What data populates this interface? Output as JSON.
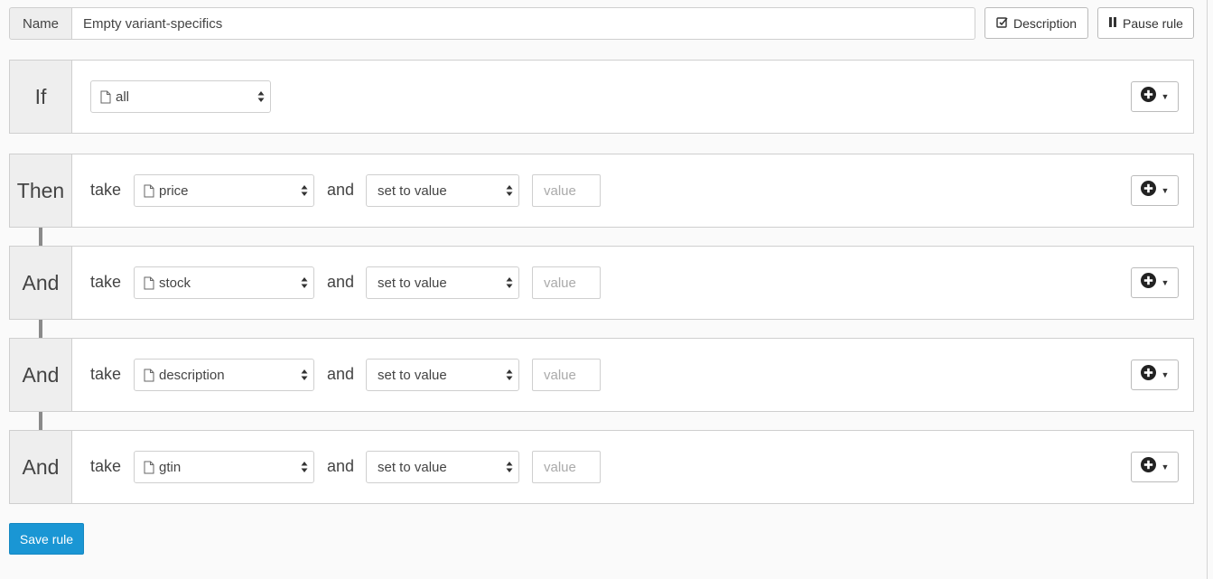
{
  "header": {
    "name_label": "Name",
    "name_value": "Empty variant-specifics",
    "description_button": "Description",
    "pause_button": "Pause rule"
  },
  "condition": {
    "label": "If",
    "selected": "all"
  },
  "actions": [
    {
      "label": "Then",
      "take_word": "take",
      "field": "price",
      "and_word": "and",
      "operation": "set to value",
      "value_placeholder": "value"
    },
    {
      "label": "And",
      "take_word": "take",
      "field": "stock",
      "and_word": "and",
      "operation": "set to value",
      "value_placeholder": "value"
    },
    {
      "label": "And",
      "take_word": "take",
      "field": "description",
      "and_word": "and",
      "operation": "set to value",
      "value_placeholder": "value"
    },
    {
      "label": "And",
      "take_word": "take",
      "field": "gtin",
      "and_word": "and",
      "operation": "set to value",
      "value_placeholder": "value"
    }
  ],
  "save_button": "Save rule",
  "colors": {
    "primary": "#1a96d4",
    "label_bg": "#eeeeee",
    "border": "#cfcfcf",
    "connector": "#8a8a8a"
  },
  "icons": {
    "description": "edit-square-icon",
    "pause": "pause-icon",
    "field": "document-icon",
    "select_arrows": "sort-arrows-icon",
    "add": "plus-circle-icon",
    "dropdown": "caret-down-icon"
  }
}
